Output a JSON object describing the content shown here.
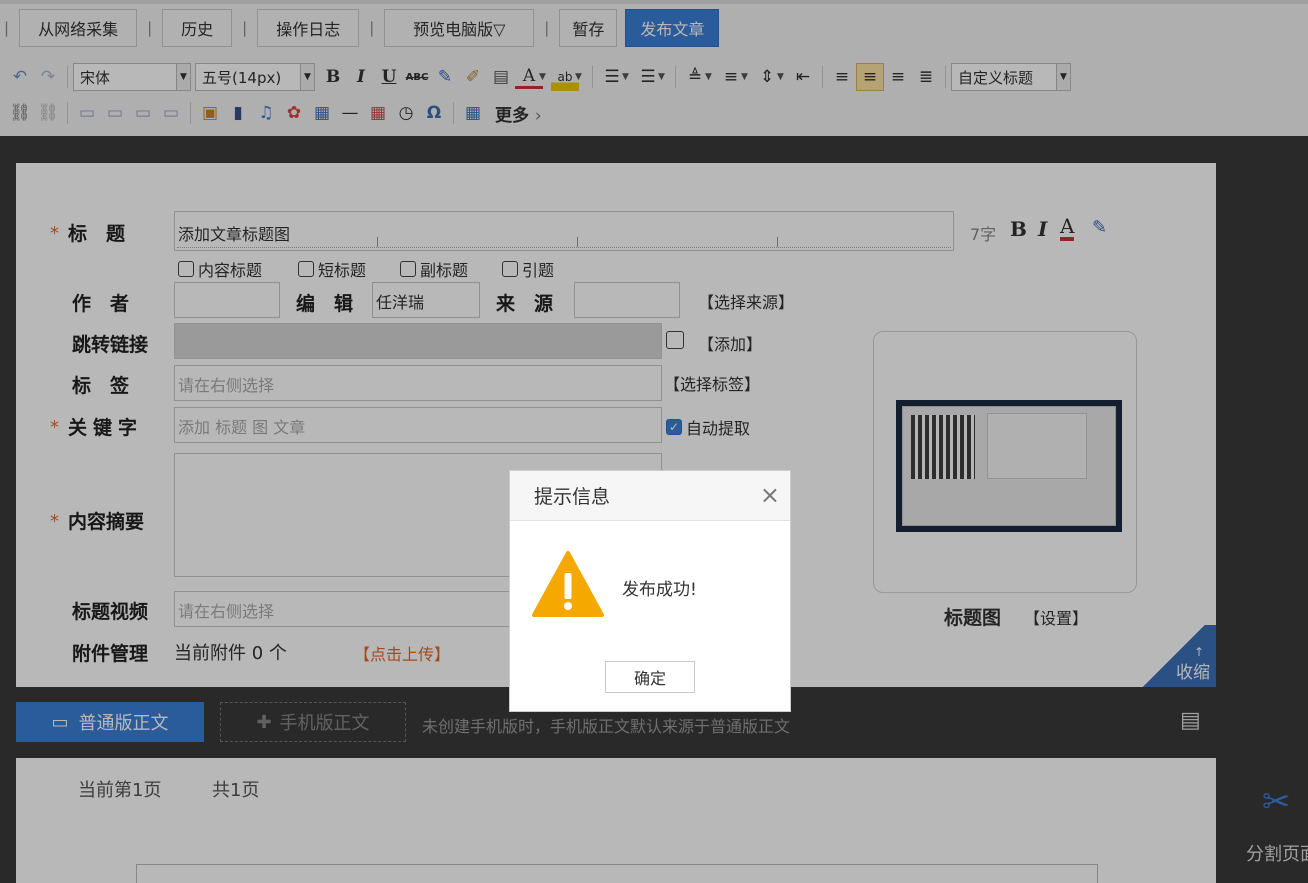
{
  "top_bar": {
    "buttons": [
      {
        "label": "从网络采集"
      },
      {
        "label": "历史"
      },
      {
        "label": "操作日志"
      },
      {
        "label": "预览电脑版▽"
      },
      {
        "label": "暂存"
      },
      {
        "label": "发布文章"
      }
    ]
  },
  "editor_toolbar": {
    "font_family": "宋体",
    "font_size": "五号(14px)",
    "custom_heading": "自定义标题",
    "more_label": "更多",
    "more_chevron": "›",
    "glyphs": {
      "bold": "B",
      "italic": "I",
      "underline": "U",
      "strike": "ABC",
      "font_color": "A",
      "highlight": "ab",
      "hr": "—",
      "omega": "Ω"
    },
    "active_align": "center"
  },
  "form": {
    "title": {
      "label": "标　题",
      "value": "添加文章标题图",
      "count": "7字"
    },
    "title_format": {
      "bold": "B",
      "italic": "I",
      "color": "A"
    },
    "title_options": [
      "内容标题",
      "短标题",
      "副标题",
      "引题"
    ],
    "author": {
      "label": "作　者",
      "value": ""
    },
    "editor": {
      "label": "编　辑",
      "value": "任洋瑞"
    },
    "source": {
      "label": "来　源",
      "value": "",
      "action": "【选择来源】"
    },
    "jump_link": {
      "label": "跳转链接",
      "action": "【添加】"
    },
    "tags": {
      "label": "标　签",
      "placeholder": "请在右侧选择",
      "action": "【选择标签】"
    },
    "keywords": {
      "label": "关键字",
      "placeholder": "添加 标题 图 文章",
      "auto_extract": "自动提取",
      "auto_checked": true
    },
    "summary": {
      "label": "内容摘要"
    },
    "title_video": {
      "label": "标题视频",
      "placeholder": "请在右侧选择"
    },
    "attachments": {
      "label": "附件管理",
      "text": "当前附件 0 个",
      "action": "【点击上传】"
    },
    "title_image": {
      "label": "标题图",
      "action": "【设置】"
    },
    "collapse": "收缩"
  },
  "editor_tabs": {
    "normal": "普通版正文",
    "mobile": "手机版正文",
    "note": "未创建手机版时，手机版正文默认来源于普通版正文"
  },
  "editor": {
    "current_page": "当前第1页",
    "total_pages": "共1页"
  },
  "side": {
    "split_label": "分割页面"
  },
  "modal": {
    "title": "提示信息",
    "close": "×",
    "message": "发布成功!",
    "ok": "确定"
  },
  "colors": {
    "accent": "#3b7ed6",
    "warning": "#f5a800",
    "required": "#e06a2a",
    "underline_red": "#d32f2f"
  }
}
